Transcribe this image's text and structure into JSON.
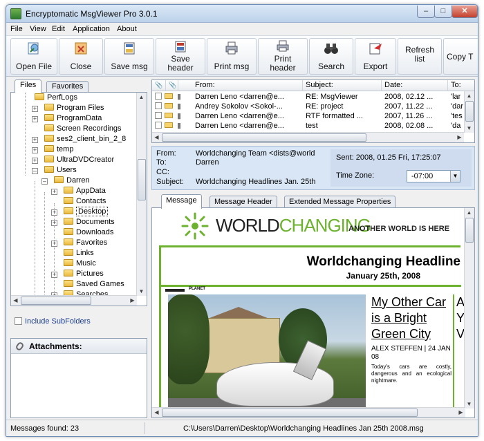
{
  "window": {
    "title": "Encryptomatic MsgViewer Pro 3.0.1",
    "min": "–",
    "max": "□",
    "close": "✕"
  },
  "menu": [
    "File",
    "View",
    "Edit",
    "Application",
    "About"
  ],
  "toolbar": [
    {
      "label": "Open File",
      "icon": "open-file-icon"
    },
    {
      "label": "Close",
      "icon": "close-file-icon"
    },
    {
      "label": "Save msg",
      "icon": "save-msg-icon"
    },
    {
      "label": "Save header",
      "icon": "save-header-icon",
      "lines": [
        "Save",
        "header"
      ]
    },
    {
      "label": "Print msg",
      "icon": "print-msg-icon"
    },
    {
      "label": "Print header",
      "icon": "print-header-icon",
      "lines": [
        "Print",
        "header"
      ]
    },
    {
      "label": "Search",
      "icon": "binoculars-icon"
    },
    {
      "label": "Export",
      "icon": "export-icon"
    },
    {
      "label": "Refresh list",
      "icon": "refresh-icon",
      "lines": [
        "Refresh",
        "list"
      ]
    },
    {
      "label": "Copy T",
      "icon": "copy-icon"
    }
  ],
  "left_tabs": [
    "Files",
    "Favorites"
  ],
  "tree": [
    "PerfLogs",
    "Program Files",
    "ProgramData",
    "Screen Recordings",
    "ses2_client_bin_2_8",
    "temp",
    "UltraDVDCreator",
    "Users",
    "Darren",
    "AppData",
    "Contacts",
    "Desktop",
    "Documents",
    "Downloads",
    "Favorites",
    "Links",
    "Music",
    "Pictures",
    "Saved Games",
    "Searches"
  ],
  "include_subfolders": "Include SubFolders",
  "attachments_label": "Attachments:",
  "list": {
    "columns": [
      "From:",
      "Subject:",
      "Date:",
      "To:"
    ],
    "rows": [
      {
        "from": "Darren Leno <darren@e...",
        "subject": "RE: MsgViewer",
        "date": "2008, 02.12 ...",
        "to": "'lar"
      },
      {
        "from": "Andrey Sokolov <Sokol-...",
        "subject": "RE: project",
        "date": "2007, 11.22 ...",
        "to": "'dar"
      },
      {
        "from": "Darren Leno <darren@e...",
        "subject": "RTF formatted ...",
        "date": "2007, 11.26 ...",
        "to": "'tes"
      },
      {
        "from": "Darren Leno <darren@e...",
        "subject": "test",
        "date": "2008, 02.08 ...",
        "to": "'da"
      }
    ]
  },
  "details": {
    "from_label": "From:",
    "from": "Worldchanging Team <dists@world",
    "to_label": "To:",
    "to": "Darren",
    "cc_label": "CC:",
    "cc": "",
    "subject_label": "Subject:",
    "subject": "Worldchanging Headlines Jan. 25th",
    "sent": "Sent: 2008, 01.25 Fri, 17:25:07",
    "timezone_label": "Time Zone:",
    "timezone": "-07:00"
  },
  "message_tabs": [
    "Message",
    "Message Header",
    "Extended Message Properties"
  ],
  "newsletter": {
    "logo_world": "WORLD",
    "logo_change": "CHANGING",
    "tagline": "ANOTHER WORLD IS HERE",
    "headline": "Worldchanging Headline",
    "date": "January 25th, 2008",
    "section": "PLANET",
    "article_title": "My Other Car is a Bright Green City",
    "article_author": "ALEX STEFFEN | 24 JAN 08",
    "article_body": "Today's cars are costly, dangerous and an ecological nightmare.",
    "side_text": "A Y V"
  },
  "status": {
    "count": "Messages found: 23",
    "path": "C:\\Users\\Darren\\Desktop\\Worldchanging Headlines Jan  25th 2008.msg"
  },
  "colors": {
    "accent_green": "#6cb22e",
    "details_bg": "#d9e6f5"
  }
}
